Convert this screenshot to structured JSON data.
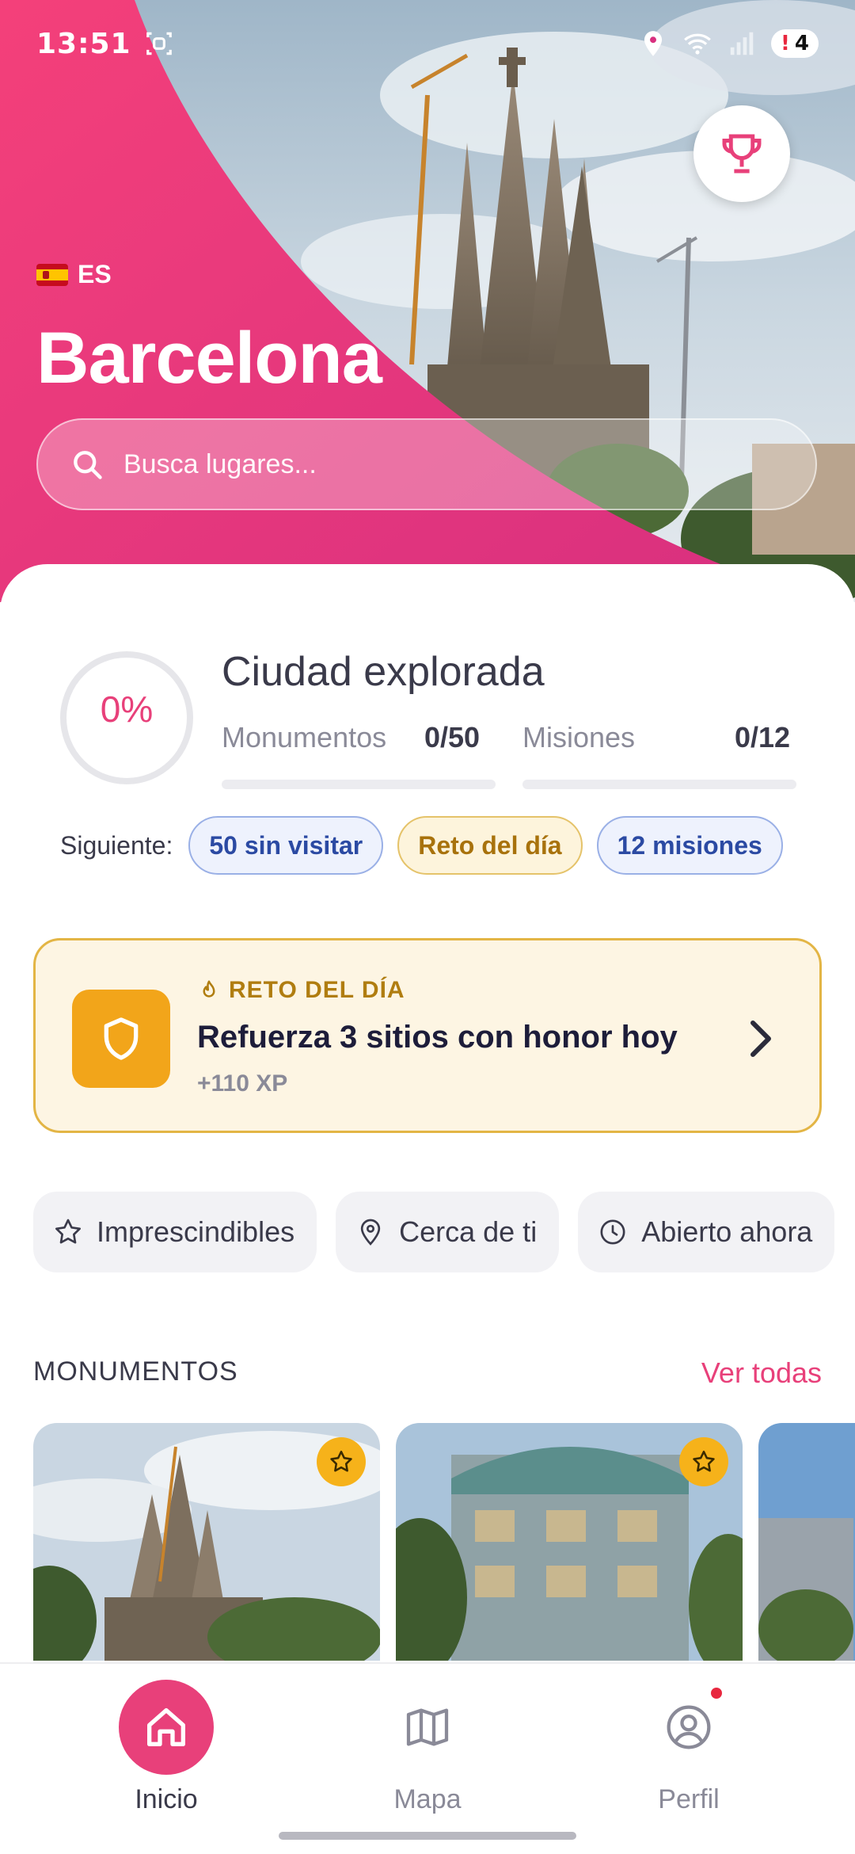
{
  "status_bar": {
    "time": "13:51",
    "battery_badge": "4",
    "alert_mark": "!"
  },
  "hero": {
    "country_code": "ES",
    "city": "Barcelona",
    "search_placeholder": "Busca lugares..."
  },
  "progress": {
    "title": "Ciudad explorada",
    "percent_label": "0%",
    "percent_value": 0,
    "monuments_label": "Monumentos",
    "monuments_value": "0/50",
    "missions_label": "Misiones",
    "missions_value": "0/12",
    "next_label": "Siguiente:",
    "chips": [
      "50 sin visitar",
      "Reto del día",
      "12 misiones"
    ]
  },
  "challenge": {
    "kicker": "RETO DEL DÍA",
    "title": "Refuerza 3 sitios con honor hoy",
    "xp": "+110 XP"
  },
  "filters": [
    {
      "label": "Imprescindibles",
      "icon": "star-outline-icon"
    },
    {
      "label": "Cerca de ti",
      "icon": "location-pin-icon"
    },
    {
      "label": "Abierto ahora",
      "icon": "clock-icon"
    }
  ],
  "monuments": {
    "section_title": "MONUMENTOS",
    "see_all": "Ver todas"
  },
  "nav": {
    "items": [
      {
        "label": "Inicio",
        "icon": "home-icon",
        "active": true
      },
      {
        "label": "Mapa",
        "icon": "map-icon",
        "active": false
      },
      {
        "label": "Perfil",
        "icon": "user-circle-icon",
        "active": false
      }
    ]
  },
  "colors": {
    "accent": "#e8407a",
    "hero_pink": "#f0376f",
    "challenge_bg": "#fdf5e3",
    "challenge_icon": "#f2a51a"
  }
}
